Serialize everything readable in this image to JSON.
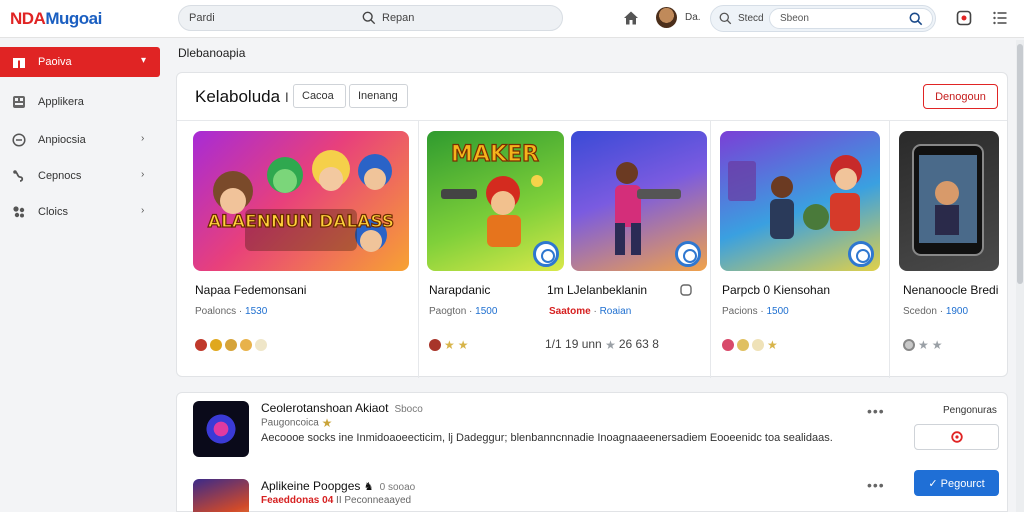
{
  "app": {
    "logo_part1": "NDA",
    "logo_part2": "Mugoai"
  },
  "topbar": {
    "search_left_text": "Pardi",
    "search_left_text2": "Repan",
    "user_name": "Da.",
    "search_right_label": "Stecd",
    "search_right_placeholder": "Sbeon"
  },
  "sidebar": {
    "items": [
      {
        "label": "Paoiva",
        "icon": "gift-icon",
        "active": true
      },
      {
        "label": "Applikera",
        "icon": "grid-icon"
      },
      {
        "label": "Anpiocsia",
        "icon": "globe-icon"
      },
      {
        "label": "Cepnocs",
        "icon": "gamepad-icon"
      },
      {
        "label": "Cloics",
        "icon": "puzzle-icon"
      }
    ]
  },
  "main": {
    "breadcrumb": "Dlebanoapia",
    "panel": {
      "title": "Kelaboluda",
      "title_suffix": "I",
      "tabs": [
        "Cacoa",
        "Inenang"
      ],
      "action_label": "Denogoun"
    },
    "cards": [
      {
        "thumb_text": "ALAENNUN DALASS",
        "name": "Napaa Fedemonsani",
        "meta_label": "Poaloncs",
        "meta_num": "1530",
        "rating_prefix": "",
        "rating_value": ""
      },
      {
        "thumb_text": "MAKER",
        "name": "Narapdanic",
        "meta_label": "Paogton",
        "meta_num": "1500",
        "rating_prefix": "",
        "rating_value": ""
      },
      {
        "thumb_text": "",
        "name": "1m LJelanbeklanin",
        "meta_label": "Saatome",
        "meta_num": "Roaian",
        "rating_prefix": "1/1 19 unn",
        "rating_value": "26 63 8"
      },
      {
        "thumb_text": "",
        "name": "Parpcb 0 Kiensohan",
        "meta_label": "Pacions",
        "meta_num": "1500",
        "rating_prefix": "",
        "rating_value": ""
      },
      {
        "thumb_text": "",
        "name": "Nenanoocle Bredi",
        "meta_label": "Scedon",
        "meta_num": "1900",
        "rating_prefix": "",
        "rating_value": ""
      }
    ],
    "list": {
      "side_label": "Pengonuras",
      "primary_label": "Pegourct",
      "items": [
        {
          "title": "Ceolerotanshoan Akiaot",
          "title_sub": "Sboco",
          "line2_a": "Paugoncoica",
          "line2_red": "",
          "line2_b": "",
          "desc": "Aecoooe socks ine Inmidoaoeecticim, lj Dadeggur; blenbanncnnadie Inoagnaaeenersadiem Eooeenidc toa sealidaas."
        },
        {
          "title": "Aplikeine Poopges",
          "title_sub": "0 sooao",
          "line2_a": "",
          "line2_red": "Feaeddonas 04",
          "line2_b": "II Peconneaayed",
          "desc": ""
        }
      ]
    }
  },
  "colors": {
    "brand_red": "#e02424",
    "brand_blue": "#1f6fd6"
  }
}
